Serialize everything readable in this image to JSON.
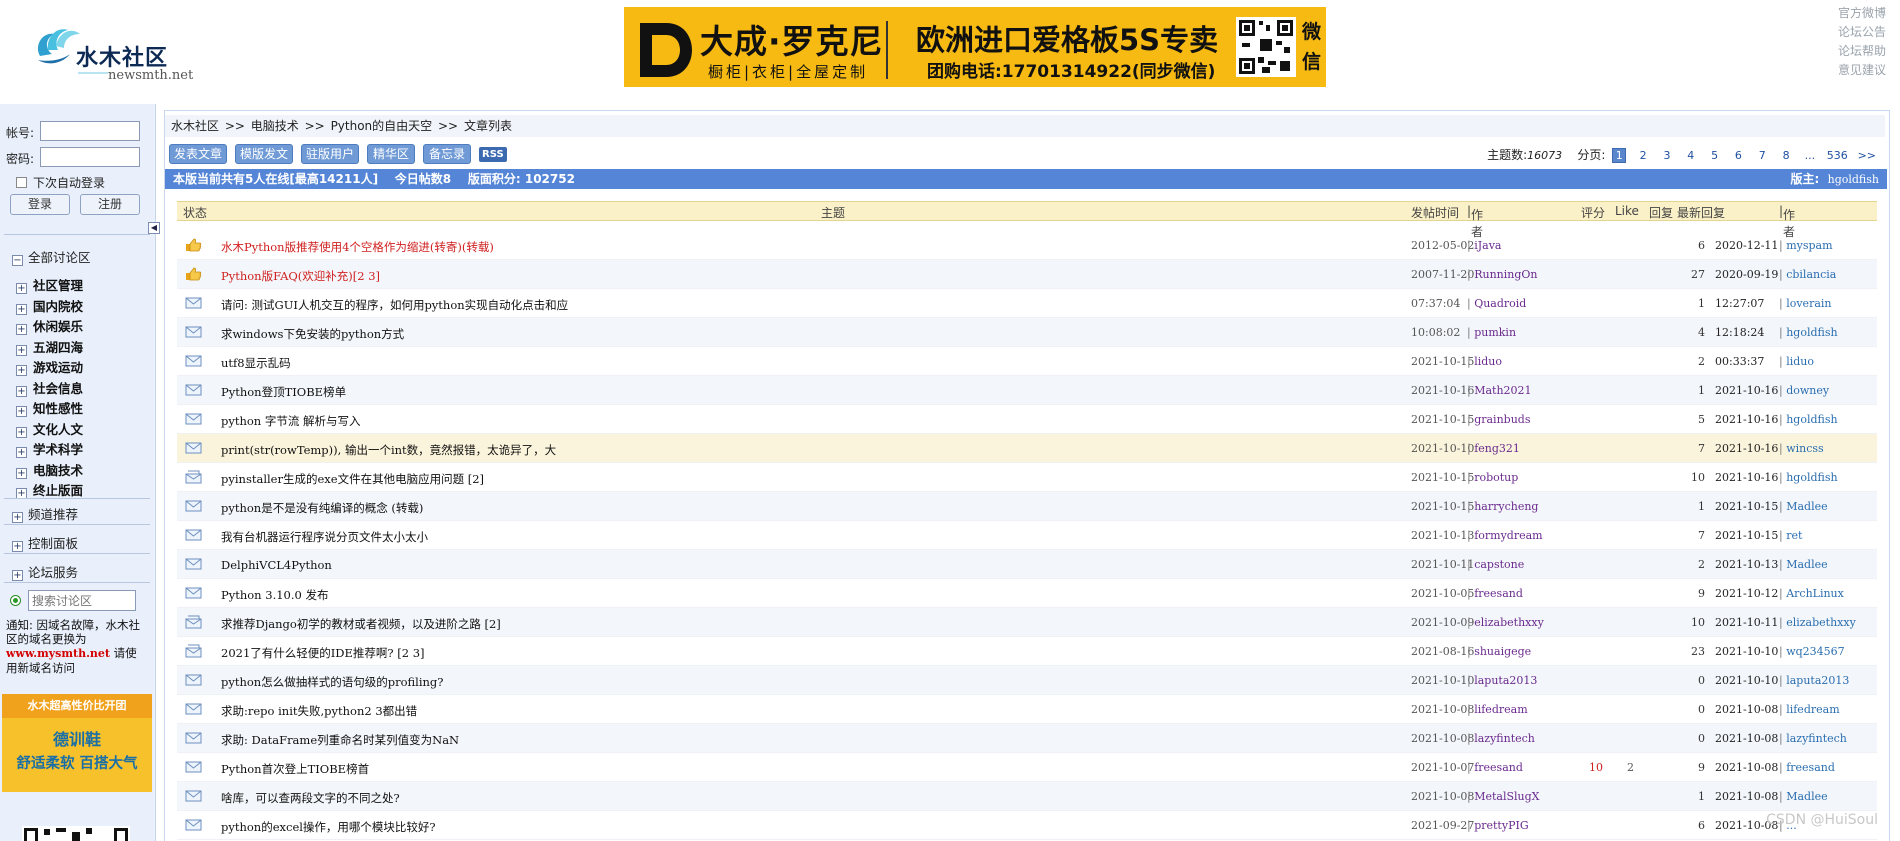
{
  "header": {
    "logo_name": "水木社区",
    "logo_domain": "newsmth.net",
    "banner": {
      "brand": "大成·罗克尼",
      "sub": "橱柜|衣柜|全屋定制",
      "title": "欧洲进口爱格板5S专卖",
      "phone": "团购电话:17701314922(同步微信)",
      "wechat": "微信",
      "accent_color": "#f7ba13"
    },
    "top_links": [
      "官方微博",
      "论坛公告",
      "论坛帮助",
      "意见建议"
    ]
  },
  "sidebar": {
    "login": {
      "account_label": "帐号:",
      "password_label": "密码:",
      "remember_label": "下次自动登录",
      "login_button": "登录",
      "register_button": "注册"
    },
    "all_boards": "全部讨论区",
    "categories": [
      "社区管理",
      "国内院校",
      "休闲娱乐",
      "五湖四海",
      "游戏运动",
      "社会信息",
      "知性感性",
      "文化人文",
      "学术科学",
      "电脑技术",
      "终止版面"
    ],
    "extra": [
      "频道推荐",
      "控制面板",
      "论坛服务"
    ],
    "search_placeholder": "搜索讨论区",
    "notice": {
      "text1": "通知: 因域名故障，水木社区的域名更换为",
      "domain": "www.mysmth.net",
      "text2": "请使用新域名访问"
    },
    "ad": {
      "line1": "水木超高性价比开团",
      "line2": "德训鞋",
      "line3": "舒适柔软 百搭大气"
    }
  },
  "main": {
    "breadcrumb": [
      "水木社区",
      ">>",
      "电脑技术",
      ">>",
      "Python的自由天空",
      ">>",
      "文章列表"
    ],
    "toolbar": [
      "发表文章",
      "模版发文",
      "驻版用户",
      "精华区",
      "备忘录",
      "RSS"
    ],
    "pager": {
      "topic_count_label": "主题数:",
      "topic_count": "16073",
      "page_label": "分页:",
      "pages": [
        "1",
        "2",
        "3",
        "4",
        "5",
        "6",
        "7",
        "8",
        "...",
        "536",
        ">>"
      ],
      "current": "1"
    },
    "status": {
      "online": "本版当前共有5人在线[最高14211人]",
      "today": "今日帖数8",
      "score": "版面积分: 102752",
      "moderator_label": "版主:",
      "moderator": "hgoldfish"
    },
    "columns": {
      "state": "状态",
      "subject": "主题",
      "post_time": "发帖时间",
      "author": "作者",
      "score": "评分",
      "like": "Like",
      "reply": "回复",
      "last_reply": "最新回复",
      "last_author": "作者"
    },
    "rows": [
      {
        "icon": "top-icon",
        "title": "水木Python版推荐使用4个空格作为缩进(转寄)(转载)",
        "red": true,
        "date": "2012-05-02",
        "author": "iJava",
        "score": "",
        "like": "",
        "reply": "6",
        "last": "2020-12-11",
        "last_author": "myspam"
      },
      {
        "icon": "top-icon",
        "title": "Python版FAQ(欢迎补充)[2 3]",
        "red": true,
        "date": "2007-11-20",
        "author": "RunningOn",
        "score": "",
        "like": "",
        "reply": "27",
        "last": "2020-09-19",
        "last_author": "cbilancia"
      },
      {
        "icon": "mail-icon",
        "title": "请问: 测试GUI人机交互的程序，如何用python实现自动化点击和应",
        "red": false,
        "date": "07:37:04",
        "author": "Quadroid",
        "score": "",
        "like": "",
        "reply": "1",
        "last": "12:27:07",
        "last_author": "loverain"
      },
      {
        "icon": "mail-icon",
        "title": "求windows下免安装的python方式",
        "red": false,
        "date": "10:08:02",
        "author": "pumkin",
        "score": "",
        "like": "",
        "reply": "4",
        "last": "12:18:24",
        "last_author": "hgoldfish"
      },
      {
        "icon": "mail-icon",
        "title": "utf8显示乱码",
        "red": false,
        "date": "2021-10-15",
        "author": "liduo",
        "score": "",
        "like": "",
        "reply": "2",
        "last": "00:33:37",
        "last_author": "liduo"
      },
      {
        "icon": "mail-icon",
        "title": "Python登顶TIOBE榜单",
        "red": false,
        "date": "2021-10-16",
        "author": "Math2021",
        "score": "",
        "like": "",
        "reply": "1",
        "last": "2021-10-16",
        "last_author": "downey"
      },
      {
        "icon": "mail-icon",
        "title": "python 字节流 解析与写入",
        "red": false,
        "date": "2021-10-15",
        "author": "grainbuds",
        "score": "",
        "like": "",
        "reply": "5",
        "last": "2021-10-16",
        "last_author": "hgoldfish"
      },
      {
        "icon": "mail-icon",
        "title": "print(str(rowTemp)), 输出一个int数，竟然报错，太诡异了，大",
        "red": false,
        "date": "2021-10-10",
        "author": "feng321",
        "score": "",
        "like": "",
        "reply": "7",
        "last": "2021-10-16",
        "last_author": "wincss"
      },
      {
        "icon": "group-icon",
        "title": "pyinstaller生成的exe文件在其他电脑应用问题 [2]",
        "red": false,
        "date": "2021-10-15",
        "author": "robotup",
        "score": "",
        "like": "",
        "reply": "10",
        "last": "2021-10-16",
        "last_author": "hgoldfish"
      },
      {
        "icon": "mail-icon",
        "title": "python是不是没有纯编译的概念 (转载)",
        "red": false,
        "date": "2021-10-15",
        "author": "harrycheng",
        "score": "",
        "like": "",
        "reply": "1",
        "last": "2021-10-15",
        "last_author": "Madlee"
      },
      {
        "icon": "mail-icon",
        "title": "我有台机器运行程序说分页文件太小太小",
        "red": false,
        "date": "2021-10-13",
        "author": "formydream",
        "score": "",
        "like": "",
        "reply": "7",
        "last": "2021-10-15",
        "last_author": "ret"
      },
      {
        "icon": "mail-icon",
        "title": "DelphiVCL4Python",
        "red": false,
        "date": "2021-10-11",
        "author": "capstone",
        "score": "",
        "like": "",
        "reply": "2",
        "last": "2021-10-13",
        "last_author": "Madlee"
      },
      {
        "icon": "mail-icon",
        "title": "Python 3.10.0 发布",
        "red": false,
        "date": "2021-10-05",
        "author": "freesand",
        "score": "",
        "like": "",
        "reply": "9",
        "last": "2021-10-12",
        "last_author": "ArchLinux"
      },
      {
        "icon": "group-icon",
        "title": "求推荐Django初学的教材或者视频，以及进阶之路 [2]",
        "red": false,
        "date": "2021-10-09",
        "author": "elizabethxxy",
        "score": "",
        "like": "",
        "reply": "10",
        "last": "2021-10-11",
        "last_author": "elizabethxxy"
      },
      {
        "icon": "group-icon",
        "title": "2021了有什么轻便的IDE推荐啊? [2 3]",
        "red": false,
        "date": "2021-08-16",
        "author": "shuaigege",
        "score": "",
        "like": "",
        "reply": "23",
        "last": "2021-10-10",
        "last_author": "wq234567"
      },
      {
        "icon": "mail-icon",
        "title": "python怎么做抽样式的语句级的profiling?",
        "red": false,
        "date": "2021-10-10",
        "author": "laputa2013",
        "score": "",
        "like": "",
        "reply": "0",
        "last": "2021-10-10",
        "last_author": "laputa2013"
      },
      {
        "icon": "mail-icon",
        "title": "求助:repo init失败,python2 3都出错",
        "red": false,
        "date": "2021-10-08",
        "author": "lifedream",
        "score": "",
        "like": "",
        "reply": "0",
        "last": "2021-10-08",
        "last_author": "lifedream"
      },
      {
        "icon": "mail-icon",
        "title": "求助: DataFrame列重命名时某列值变为NaN",
        "red": false,
        "date": "2021-10-08",
        "author": "lazyfintech",
        "score": "",
        "like": "",
        "reply": "0",
        "last": "2021-10-08",
        "last_author": "lazyfintech"
      },
      {
        "icon": "mail-icon",
        "title": "Python首次登上TIOBE榜首",
        "red": false,
        "date": "2021-10-07",
        "author": "freesand",
        "score": "10",
        "like": "2",
        "reply": "9",
        "last": "2021-10-08",
        "last_author": "freesand"
      },
      {
        "icon": "mail-icon",
        "title": "啥库，可以查两段文字的不同之处?",
        "red": false,
        "date": "2021-10-08",
        "author": "MetalSlugX",
        "score": "",
        "like": "",
        "reply": "1",
        "last": "2021-10-08",
        "last_author": "Madlee"
      },
      {
        "icon": "mail-icon",
        "title": "python的excel操作，用哪个模块比较好?",
        "red": false,
        "date": "2021-09-27",
        "author": "prettyPIG",
        "score": "",
        "like": "",
        "reply": "6",
        "last": "2021-10-08",
        "last_author": "..."
      }
    ],
    "watermark": "CSDN @HuiSoul"
  },
  "colors": {
    "status_bar": "#5485d6",
    "toolbar_button": "#6f9ad6",
    "header_row": "#fbf1c8",
    "pinned_title": "#d02020",
    "author": "#6a2a8e",
    "last_author": "#2a6eb0"
  }
}
